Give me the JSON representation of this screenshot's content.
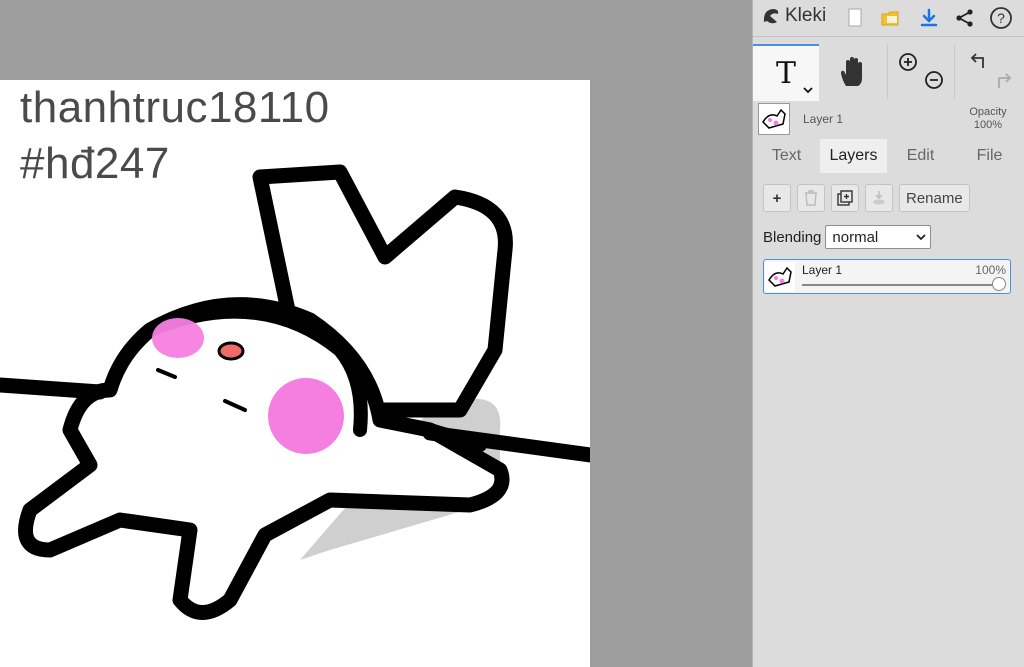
{
  "app": {
    "name": "Kleki"
  },
  "canvas": {
    "lines": [
      "thanhtruc18110",
      "#hđ247"
    ]
  },
  "topbar": {
    "icons": [
      "new-file-icon",
      "open-folder-icon",
      "download-icon",
      "share-icon",
      "help-icon"
    ]
  },
  "tools": {
    "text": {
      "glyph": "T"
    },
    "hand": {
      "icon": "hand-icon"
    },
    "zoom": {
      "icons": [
        "zoom-in-icon",
        "zoom-out-icon"
      ]
    },
    "history": {
      "icons": [
        "undo-icon",
        "redo-icon"
      ]
    }
  },
  "layer_info": {
    "name": "Layer 1",
    "opacity_label": "Opacity",
    "opacity_value": "100%"
  },
  "tabs": [
    {
      "label": "Text",
      "active": false
    },
    {
      "label": "Layers",
      "active": true
    },
    {
      "label": "Edit",
      "active": false
    },
    {
      "label": "File",
      "active": false
    }
  ],
  "layer_actions": {
    "add": "+",
    "rename": "Rename"
  },
  "blending": {
    "label": "Blending",
    "value": "normal"
  },
  "layers": [
    {
      "name": "Layer 1",
      "opacity": "100%",
      "opacity_fraction": 1.0
    }
  ],
  "colors": {
    "accent": "#4a90e2",
    "workspace": "#9e9e9e",
    "panel": "#dcdcdc",
    "download": "#1a73e8",
    "folder": "#f2c12e",
    "cheek": "#f57fe0",
    "nose": "#f06a6a"
  }
}
